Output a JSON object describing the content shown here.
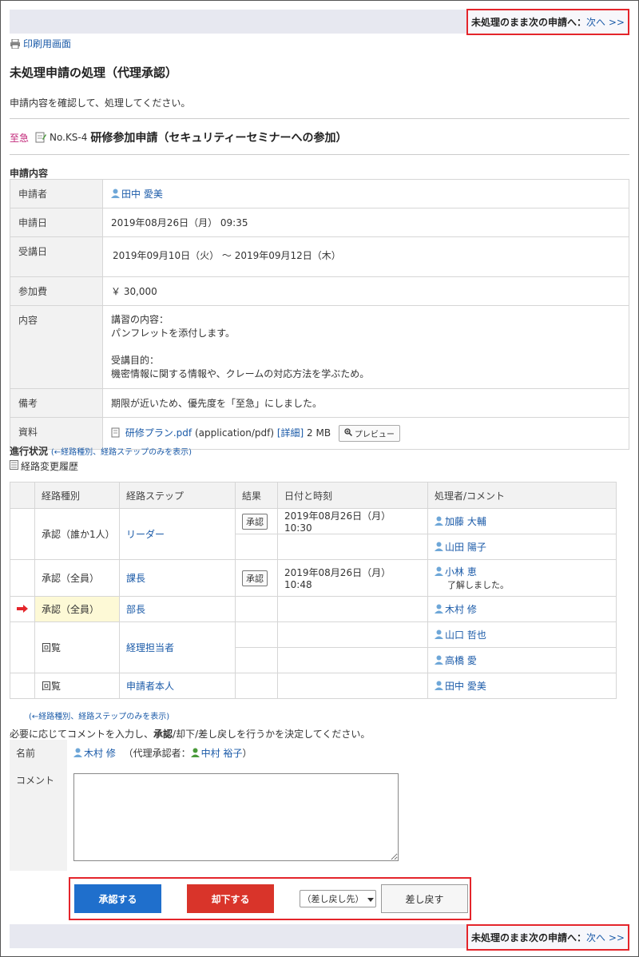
{
  "nav": {
    "next_label": "未処理のまま次の申請へ：",
    "next_link": "次へ >>"
  },
  "print_link": "印刷用画面",
  "page_title": "未処理申請の処理（代理承認）",
  "description": "申請内容を確認して、処理してください。",
  "request": {
    "priority": "至急",
    "number": "No.KS-4",
    "title": "研修参加申請（セキュリティーセミナーへの参加）"
  },
  "details_heading": "申請内容",
  "details": {
    "applicant_label": "申請者",
    "applicant": "田中 愛美",
    "applied_label": "申請日",
    "applied": "2019年08月26日（月） 09:35",
    "course_label": "受講日",
    "course": "2019年09月10日（火） 〜 2019年09月12日（木）",
    "fee_label": "参加費",
    "fee": "￥ 30,000",
    "content_label": "内容",
    "content_lines": [
      "講習の内容：",
      "パンフレットを添付します。",
      "",
      "受講目的：",
      "機密情報に関する情報や、クレームの対応方法を学ぶため。"
    ],
    "remarks_label": "備考",
    "remarks": "期限が近いため、優先度を「至急」にしました。",
    "file_label": "資料",
    "file_name": "研修プラン.pdf",
    "file_type": "(application/pdf)",
    "file_detail": "[詳細]",
    "file_size": "2 MB",
    "preview": "プレビュー"
  },
  "progress": {
    "heading": "進行状況",
    "filter_link": "(←経路種別、経路ステップのみを表示)",
    "history_link": "経路変更履歴",
    "columns": [
      "経路種別",
      "経路ステップ",
      "結果",
      "日付と時刻",
      "処理者/コメント"
    ],
    "rows": [
      {
        "type": "承認（誰か1人）",
        "step": "リーダー",
        "result": "承認",
        "date": "2019年08月26日（月） 10:30",
        "persons": [
          "加藤 大輔",
          "山田 陽子"
        ]
      },
      {
        "type": "承認（全員）",
        "step": "課長",
        "result": "承認",
        "date": "2019年08月26日（月） 10:48",
        "persons": [
          "小林 恵"
        ],
        "comment": "了解しました。"
      },
      {
        "type": "承認（全員）",
        "step": "部長",
        "persons": [
          "木村 修"
        ]
      },
      {
        "type": "回覧",
        "step": "経理担当者",
        "persons": [
          "山口 哲也",
          "高橋 愛"
        ]
      },
      {
        "type": "回覧",
        "step": "申請者本人",
        "persons": [
          "田中 愛美"
        ]
      }
    ],
    "filter_link_bottom": "(←経路種別、経路ステップのみを表示)"
  },
  "instruction_pre": "必要に応じてコメントを入力し、",
  "instruction_bold": "承認",
  "instruction_post": "/却下/差し戻しを行うかを決定してください。",
  "form": {
    "name_label": "名前",
    "name": "木村 修",
    "proxy_label": "（代理承認者：",
    "proxy_name": "中村 裕子",
    "proxy_close": "）",
    "comment_label": "コメント",
    "comment_value": ""
  },
  "actions": {
    "approve": "承認する",
    "reject": "却下する",
    "return_target": "（差し戻し先）",
    "return": "差し戻す"
  },
  "colors": {
    "approve": "#1f6fcc",
    "reject": "#d9342a",
    "highlight": "#e4252b",
    "link": "#1a5aa8"
  }
}
